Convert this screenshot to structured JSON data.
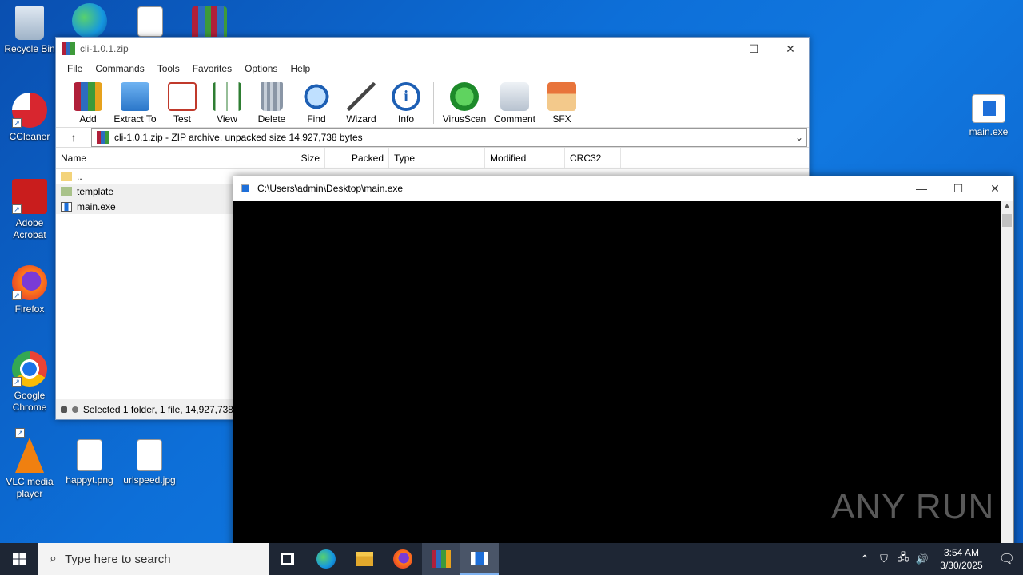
{
  "desktop": {
    "icons": [
      {
        "label": "Recycle Bin"
      },
      {
        "label": "CCleaner"
      },
      {
        "label": "Adobe Acrobat"
      },
      {
        "label": "Firefox"
      },
      {
        "label": "Google Chrome"
      },
      {
        "label": "VLC media player"
      },
      {
        "label": "happyt.png"
      },
      {
        "label": "urlspeed.jpg"
      },
      {
        "label": "main.exe"
      }
    ],
    "watermark": "ANY RUN"
  },
  "winrar": {
    "title": "cli-1.0.1.zip",
    "menu": [
      "File",
      "Commands",
      "Tools",
      "Favorites",
      "Options",
      "Help"
    ],
    "toolbar": [
      "Add",
      "Extract To",
      "Test",
      "View",
      "Delete",
      "Find",
      "Wizard",
      "Info",
      "VirusScan",
      "Comment",
      "SFX"
    ],
    "address": "cli-1.0.1.zip - ZIP archive, unpacked size 14,927,738 bytes",
    "columns": [
      "Name",
      "Size",
      "Packed",
      "Type",
      "Modified",
      "CRC32"
    ],
    "rows": [
      {
        "name": ".."
      },
      {
        "name": "template"
      },
      {
        "name": "main.exe"
      }
    ],
    "status": "Selected 1 folder, 1 file, 14,927,738"
  },
  "console": {
    "title": "C:\\Users\\admin\\Desktop\\main.exe"
  },
  "taskbar": {
    "search_placeholder": "Type here to search",
    "time": "3:54 AM",
    "date": "3/30/2025"
  }
}
